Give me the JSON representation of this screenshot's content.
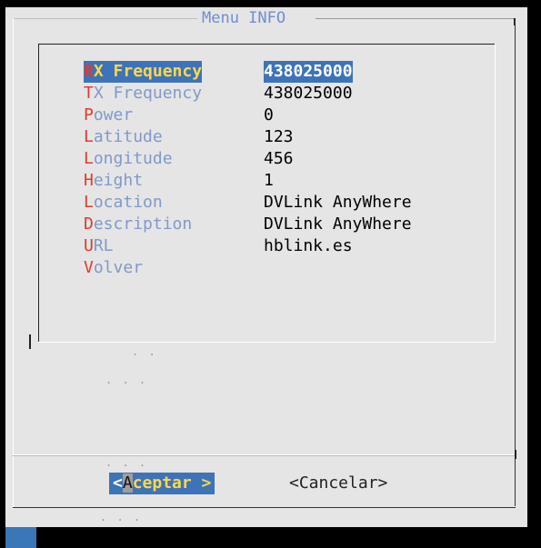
{
  "dialog": {
    "title": "Menu INFO"
  },
  "menu": {
    "items": [
      {
        "hot": "R",
        "rest": "X Frequency",
        "value": "438025000"
      },
      {
        "hot": "T",
        "rest": "X Frequency",
        "value": "438025000"
      },
      {
        "hot": "P",
        "rest": "ower",
        "value": "0"
      },
      {
        "hot": "L",
        "rest": "atitude",
        "value": "123"
      },
      {
        "hot": "L",
        "rest": "ongitude",
        "value": "456"
      },
      {
        "hot": "H",
        "rest": "eight",
        "value": "1"
      },
      {
        "hot": "L",
        "rest": "ocation",
        "value": "DVLink AnyWhere"
      },
      {
        "hot": "D",
        "rest": "escription",
        "value": "DVLink AnyWhere"
      },
      {
        "hot": "U",
        "rest": "RL",
        "value": "hblink.es"
      },
      {
        "hot": "V",
        "rest": "olver",
        "value": ""
      }
    ],
    "selected_index": 0
  },
  "buttons": {
    "ok_left": "<",
    "ok_hot": "A",
    "ok_rest": "ceptar >",
    "cancel": "<Cancelar>"
  },
  "colors": {
    "dialog_bg": "#e5e5e5",
    "selection_bg": "#3e73b8",
    "hotkey": "#e23a2b",
    "label": "#7f9ac9",
    "title": "#6d8fcf",
    "selected_label": "#ffd84a"
  }
}
